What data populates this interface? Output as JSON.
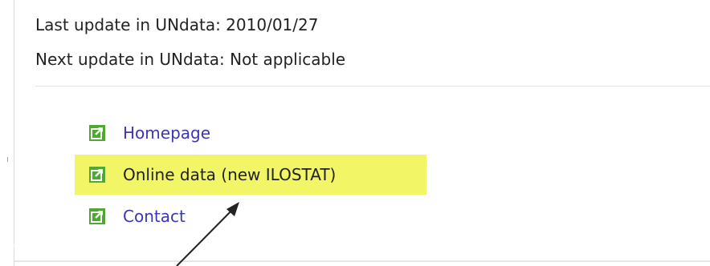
{
  "update_info": {
    "last_update": "Last update in UNdata: 2010/01/27",
    "next_update": "Next update in UNdata: Not applicable"
  },
  "links": [
    {
      "label": "Homepage",
      "icon": "external-link-icon",
      "highlighted": false
    },
    {
      "label": "Online data (new ILOSTAT)",
      "icon": "external-link-icon",
      "highlighted": true
    },
    {
      "label": "Contact",
      "icon": "external-link-icon",
      "highlighted": false
    }
  ],
  "colors": {
    "link": "#3a37b3",
    "icon_green": "#4fa832",
    "highlight": "#f1f566",
    "arrow": "#222222"
  },
  "annotation": {
    "type": "arrow",
    "target": "Online data (new ILOSTAT)"
  }
}
